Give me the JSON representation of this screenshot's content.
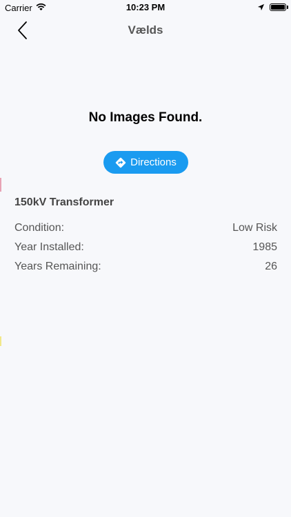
{
  "status_bar": {
    "carrier": "Carrier",
    "time": "10:23 PM"
  },
  "nav": {
    "title": "Vælds",
    "back_icon": "chevron-left-icon"
  },
  "gallery": {
    "empty_message": "No Images Found."
  },
  "directions": {
    "label": "Directions",
    "icon": "directions-diamond-icon",
    "color": "#1a9bf0"
  },
  "asset": {
    "title": "150kV Transformer",
    "details": [
      {
        "label": "Condition:",
        "value": "Low Risk"
      },
      {
        "label": "Year Installed:",
        "value": "1985"
      },
      {
        "label": "Years Remaining:",
        "value": "26"
      }
    ]
  },
  "colors": {
    "background": "#f7f8fb",
    "accent": "#1a9bf0"
  }
}
